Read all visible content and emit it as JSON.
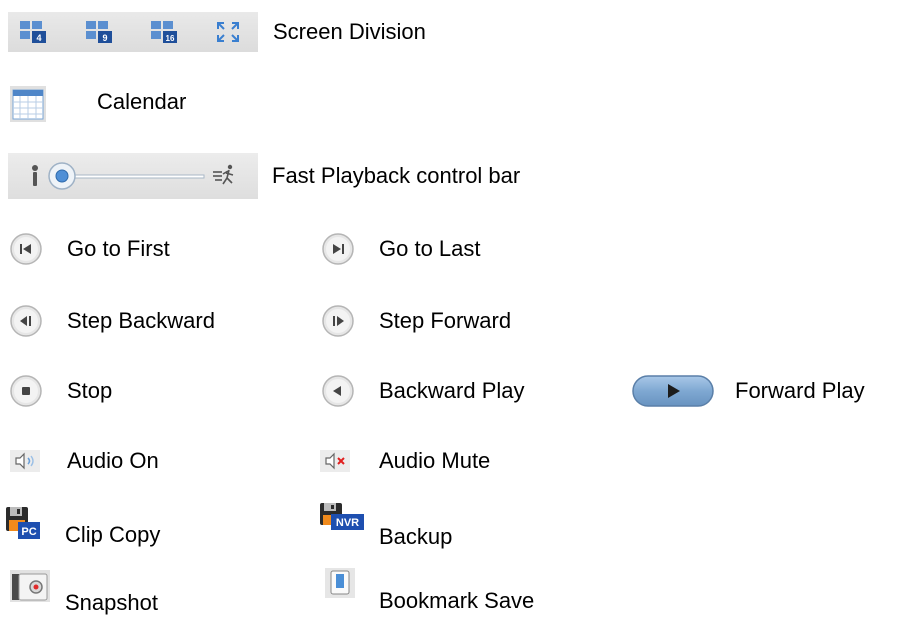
{
  "rows": {
    "screen_division": "Screen Division",
    "calendar": "Calendar",
    "fast_playback": "Fast Playback control bar",
    "go_first": "Go to First",
    "go_last": "Go to Last",
    "step_backward": "Step Backward",
    "step_forward": "Step Forward",
    "stop": "Stop",
    "backward_play": "Backward Play",
    "forward_play": "Forward Play",
    "audio_on": "Audio On",
    "audio_mute": "Audio Mute",
    "clip_copy": "Clip Copy",
    "backup": "Backup",
    "snapshot": "Snapshot",
    "bookmark_save": "Bookmark Save"
  },
  "division_badges": [
    "4",
    "9",
    "16"
  ],
  "icon_badges": {
    "clip_copy": "PC",
    "backup": "NVR"
  },
  "colors": {
    "icon_blue": "#3a6fb0",
    "badge_blue": "#2d55a8",
    "mute_red": "#e02020",
    "floppy_orange": "#f08a1c"
  }
}
